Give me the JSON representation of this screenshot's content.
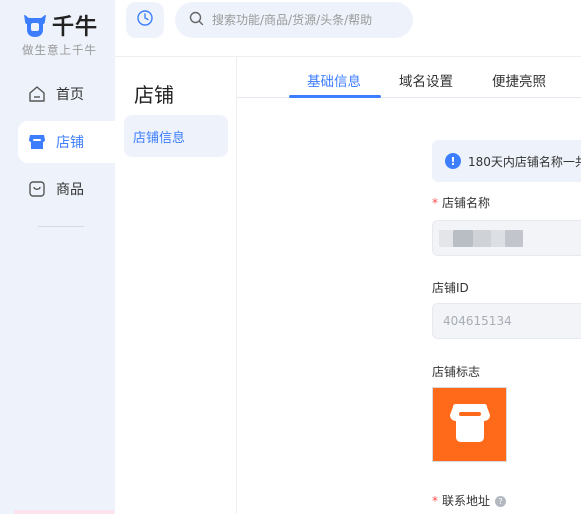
{
  "brand": {
    "name": "千牛",
    "slogan": "做生意上千牛",
    "accent": "#3d7eff"
  },
  "search": {
    "placeholder": "搜索功能/商品/货源/头条/帮助"
  },
  "nav": {
    "home": {
      "label": "首页",
      "icon": "home-icon"
    },
    "shop": {
      "label": "店铺",
      "icon": "store-icon",
      "active": true
    },
    "goods": {
      "label": "商品",
      "icon": "bag-icon"
    }
  },
  "sub_panel": {
    "title": "店铺",
    "items": [
      {
        "label": "店铺信息",
        "active": true
      }
    ]
  },
  "tabs": [
    {
      "label": "基础信息",
      "active": true
    },
    {
      "label": "域名设置"
    },
    {
      "label": "便捷亮照"
    }
  ],
  "form": {
    "notice": "180天内店铺名称一共",
    "shop_name_label": "店铺名称",
    "shop_id_label": "店铺ID",
    "shop_id_value": "404615134",
    "shop_logo_label": "店铺标志",
    "address_label": "联系地址",
    "required_mark": "*"
  }
}
